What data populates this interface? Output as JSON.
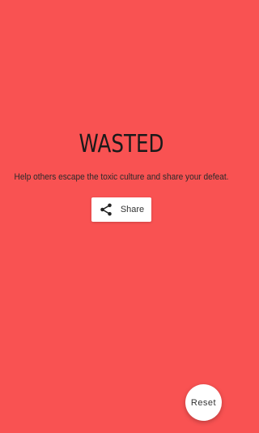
{
  "screen": {
    "title": "WASTED",
    "message": "Help others escape the toxic culture and share your defeat.",
    "background_color": "#f95252"
  },
  "share_button": {
    "label": "Share",
    "icon": "share-icon"
  },
  "reset_button": {
    "label": "Reset"
  }
}
